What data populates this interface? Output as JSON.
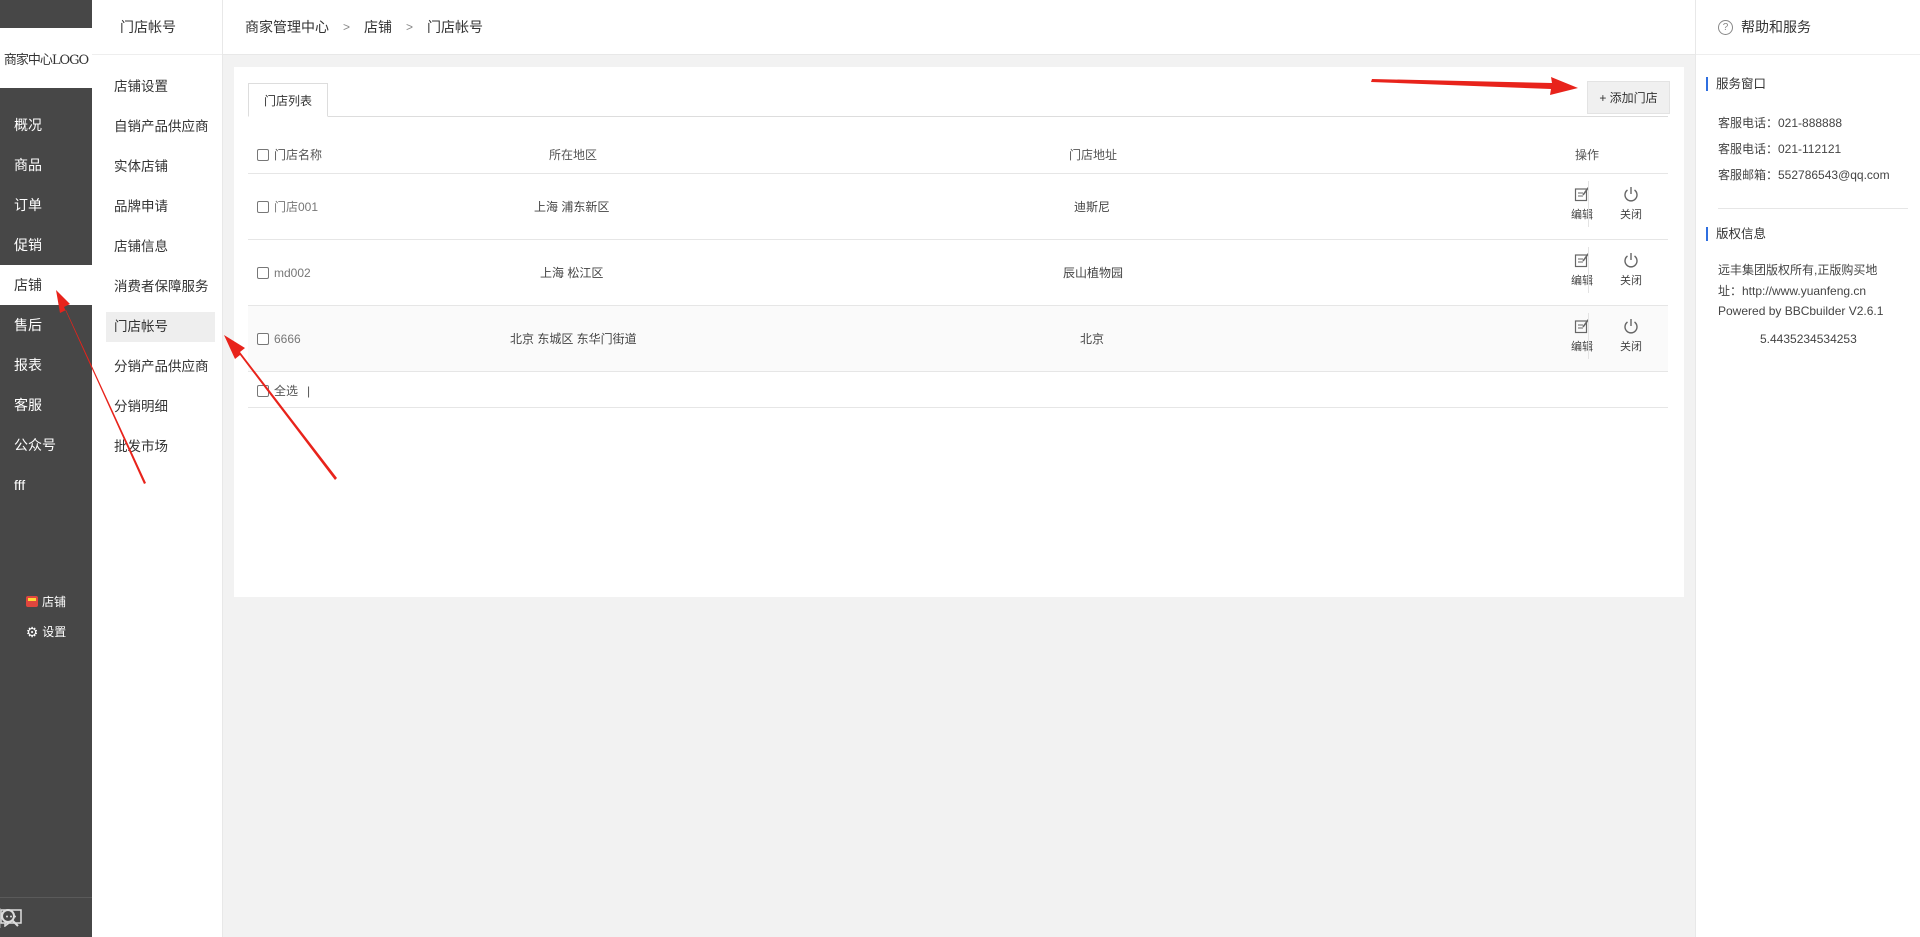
{
  "nav": {
    "logo": "商家中心LOGO",
    "items": [
      {
        "label": "概况"
      },
      {
        "label": "商品"
      },
      {
        "label": "订单"
      },
      {
        "label": "促销"
      },
      {
        "label": "店铺",
        "active": true
      },
      {
        "label": "售后"
      },
      {
        "label": "报表"
      },
      {
        "label": "客服"
      },
      {
        "label": "公众号"
      },
      {
        "label": "fff"
      }
    ],
    "store_link": "店铺",
    "settings_link": "设置"
  },
  "subnav": {
    "title": "门店帐号",
    "items": [
      {
        "label": "店铺设置"
      },
      {
        "label": "自销产品供应商"
      },
      {
        "label": "实体店铺"
      },
      {
        "label": "品牌申请"
      },
      {
        "label": "店铺信息"
      },
      {
        "label": "消费者保障服务"
      },
      {
        "label": "门店帐号",
        "active": true
      },
      {
        "label": "分销产品供应商"
      },
      {
        "label": "分销明细"
      },
      {
        "label": "批发市场"
      }
    ]
  },
  "breadcrumb": [
    "商家管理中心",
    "店铺",
    "门店帐号"
  ],
  "breadcrumb_separator": ">",
  "main": {
    "tab_label": "门店列表",
    "add_button": "+ 添加门店",
    "columns": [
      "门店名称",
      "所在地区",
      "门店地址",
      "操作"
    ],
    "rows": [
      {
        "name": "门店001",
        "region": "上海 浦东新区",
        "address": "迪斯尼"
      },
      {
        "name": "md002",
        "region": "上海 松江区",
        "address": "辰山植物园"
      },
      {
        "name": "6666",
        "region": "北京 东城区 东华门街道",
        "address": "北京",
        "highlight": true
      }
    ],
    "edit_label": "编辑",
    "close_label": "关闭",
    "select_all": "全选",
    "select_all_sep": "|"
  },
  "help": {
    "title": "帮助和服务",
    "service_title": "服务窗口",
    "service_lines": [
      "客服电话：021-888888",
      "客服电话：021-112121",
      "客服邮箱：552786543@qq.com"
    ],
    "copyright_title": "版权信息",
    "copyright_lines": [
      "远丰集团版权所有,正版购买地",
      "址：http://www.yuanfeng.cn",
      "Powered by BBCbuilder V2.6.1"
    ],
    "version_number": "5.4435234534253"
  },
  "colors": {
    "nav_bg": "#474747",
    "accent_blue": "#2f6fe0",
    "annotation_arrow": "#e8231b"
  }
}
